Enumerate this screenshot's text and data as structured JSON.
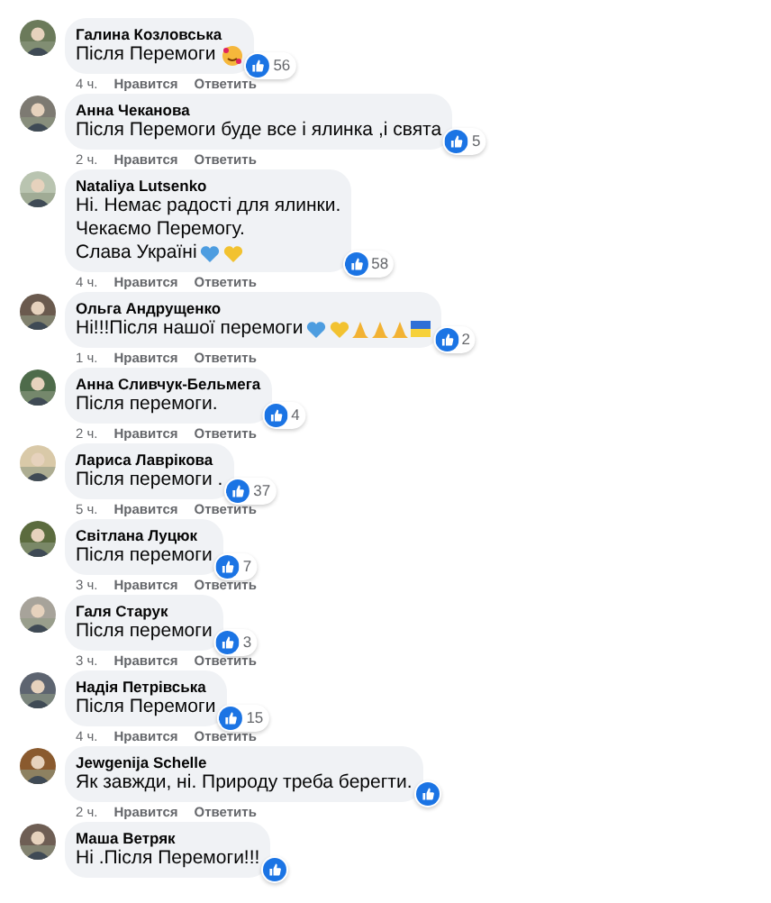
{
  "comments": [
    {
      "author": "Галина Козловська",
      "lines": [
        "Після Перемоги"
      ],
      "emojis": [
        {
          "kind": "smiling-hearts"
        }
      ],
      "likes": "56",
      "time": "4 ч.",
      "like": "Нравится",
      "reply": "Ответить"
    },
    {
      "author": "Анна Чеканова",
      "lines": [
        "Після Перемоги буде все і ялинка ,і свята"
      ],
      "likes": "5",
      "time": "2 ч.",
      "like": "Нравится",
      "reply": "Ответить"
    },
    {
      "author": "Nataliya Lutsenko",
      "lines": [
        "Ні. Немає радості для ялинки.",
        "Чекаємо Перемогу.",
        "Слава Україні"
      ],
      "emojis": [
        {
          "kind": "heart",
          "color": "#4d9de0"
        },
        {
          "kind": "heart",
          "color": "#f2c230"
        }
      ],
      "likes": "58",
      "time": "4 ч.",
      "like": "Нравится",
      "reply": "Ответить"
    },
    {
      "author": "Ольга Андрущенко",
      "lines": [
        "Ні!!!Після нашої перемоги"
      ],
      "emojis": [
        {
          "kind": "heart",
          "color": "#4d9de0"
        },
        {
          "kind": "heart",
          "color": "#f2c230"
        },
        {
          "kind": "pray"
        },
        {
          "kind": "pray"
        },
        {
          "kind": "pray"
        },
        {
          "kind": "flag"
        }
      ],
      "likes": "2",
      "time": "1 ч.",
      "like": "Нравится",
      "reply": "Ответить"
    },
    {
      "author": "Анна Сливчук-Бельмега",
      "lines": [
        "Після перемоги."
      ],
      "likes": "4",
      "time": "2 ч.",
      "like": "Нравится",
      "reply": "Ответить"
    },
    {
      "author": "Лариса Лаврікова",
      "lines": [
        "Після перемоги ."
      ],
      "likes": "37",
      "time": "5 ч.",
      "like": "Нравится",
      "reply": "Ответить"
    },
    {
      "author": "Світлана Луцюк",
      "lines": [
        "Після перемоги"
      ],
      "likes": "7",
      "time": "3 ч.",
      "like": "Нравится",
      "reply": "Ответить"
    },
    {
      "author": "Галя Старук",
      "lines": [
        "Після перемоги"
      ],
      "likes": "3",
      "time": "3 ч.",
      "like": "Нравится",
      "reply": "Ответить"
    },
    {
      "author": "Надія Петрівська",
      "lines": [
        "Після Перемоги"
      ],
      "likes": "15",
      "time": "4 ч.",
      "like": "Нравится",
      "reply": "Ответить"
    },
    {
      "author": "Jewgenija Schelle",
      "lines": [
        "Як завжди, ні. Природу треба берегти."
      ],
      "time": "2 ч.",
      "like": "Нравится",
      "reply": "Ответить"
    },
    {
      "author": "Маша Ветряк",
      "lines": [
        "Ні .Після Перемоги!!!"
      ]
    }
  ]
}
